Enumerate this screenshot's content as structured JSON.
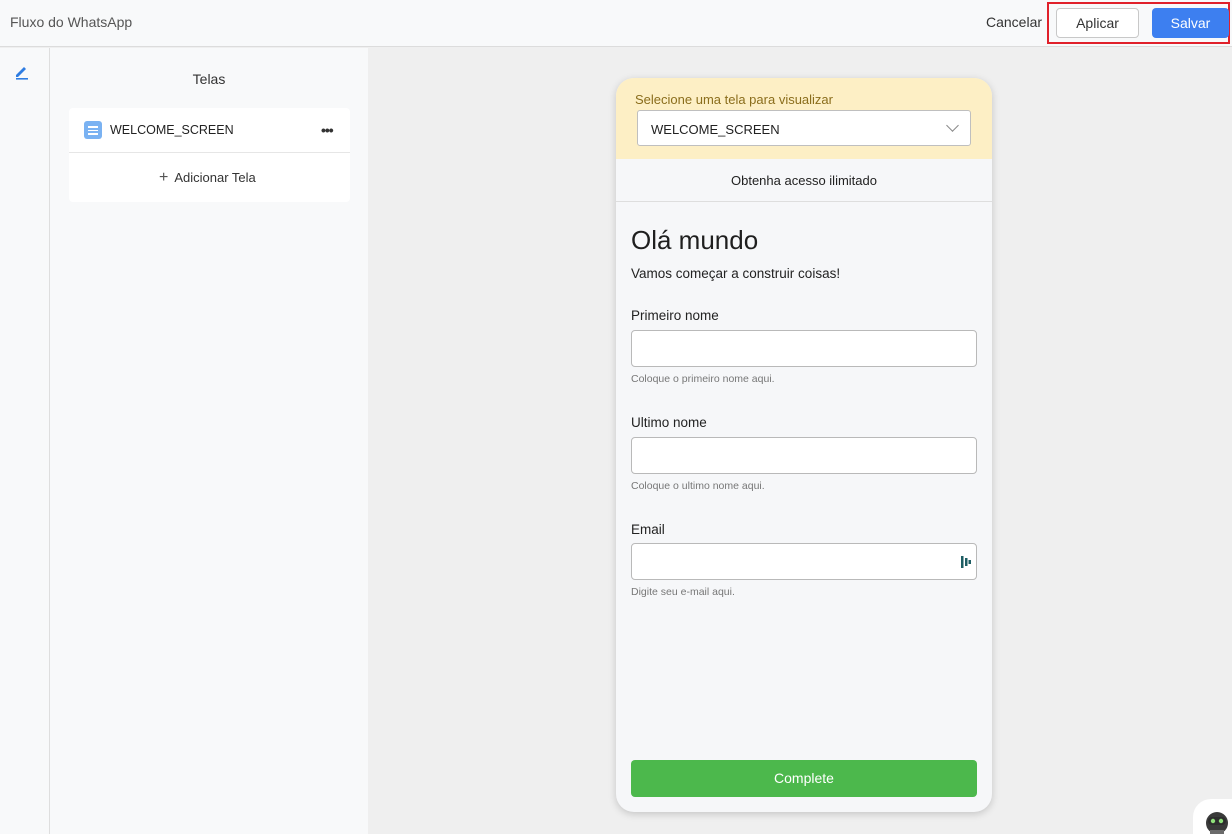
{
  "header": {
    "title": "Fluxo do WhatsApp",
    "cancel_label": "Cancelar",
    "apply_label": "Aplicar",
    "save_label": "Salvar"
  },
  "rail": {
    "items": [
      {
        "icon": "pencil-icon"
      }
    ]
  },
  "screens_panel": {
    "title": "Telas",
    "items": [
      {
        "label": "WELCOME_SCREEN",
        "icon": "document-icon",
        "menu_icon": "more-icon"
      }
    ],
    "add_label": "Adicionar Tela"
  },
  "preview": {
    "select_label": "Selecione uma tela para visualizar",
    "selected_screen": "WELCOME_SCREEN",
    "banner": "Obtenha acesso ilimitado",
    "heading": "Olá mundo",
    "subheading": "Vamos começar a construir coisas!",
    "fields": [
      {
        "label": "Primeiro nome",
        "value": "",
        "help": "Coloque o primeiro nome aqui."
      },
      {
        "label": "Ultimo nome",
        "value": "",
        "help": "Coloque o ultimo nome aqui."
      },
      {
        "label": "Email",
        "value": "",
        "help": "Digite seu e-mail aqui."
      }
    ],
    "complete_label": "Complete"
  },
  "colors": {
    "primary": "#3d7ff0",
    "highlight": "#e0202a",
    "complete": "#4cb84c",
    "preview_header": "#fdefc5"
  }
}
